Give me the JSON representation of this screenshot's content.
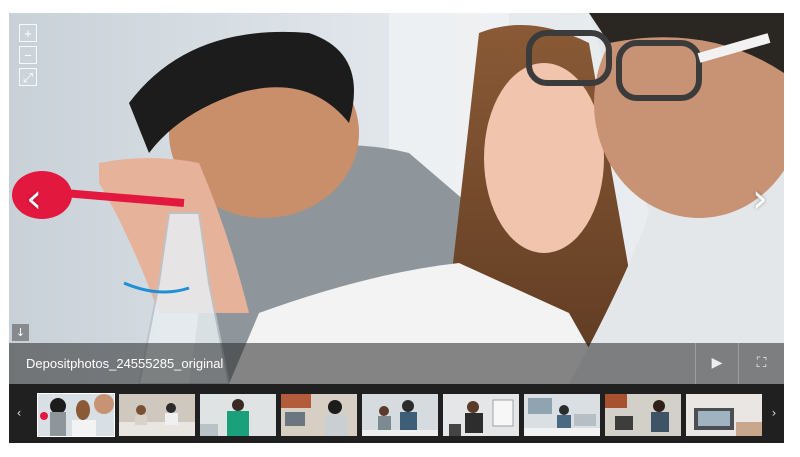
{
  "slide": {
    "caption": "Depositphotos_24555285_original"
  },
  "controls": {
    "zoom_in_icon": "+",
    "zoom_out_icon": "−",
    "reset_icon": "⤢",
    "prev_icon": "‹",
    "next_icon": "›",
    "download_icon": "↓",
    "play_icon": "▶",
    "fullscreen_icon": "⛶"
  },
  "thumbnails": {
    "prev_icon": "‹",
    "next_icon": "›",
    "active_index": 0,
    "count": 9
  },
  "colors": {
    "flask_liquid": "#e3183f",
    "caption_bar": "#282828",
    "strip_bg": "#202020"
  }
}
